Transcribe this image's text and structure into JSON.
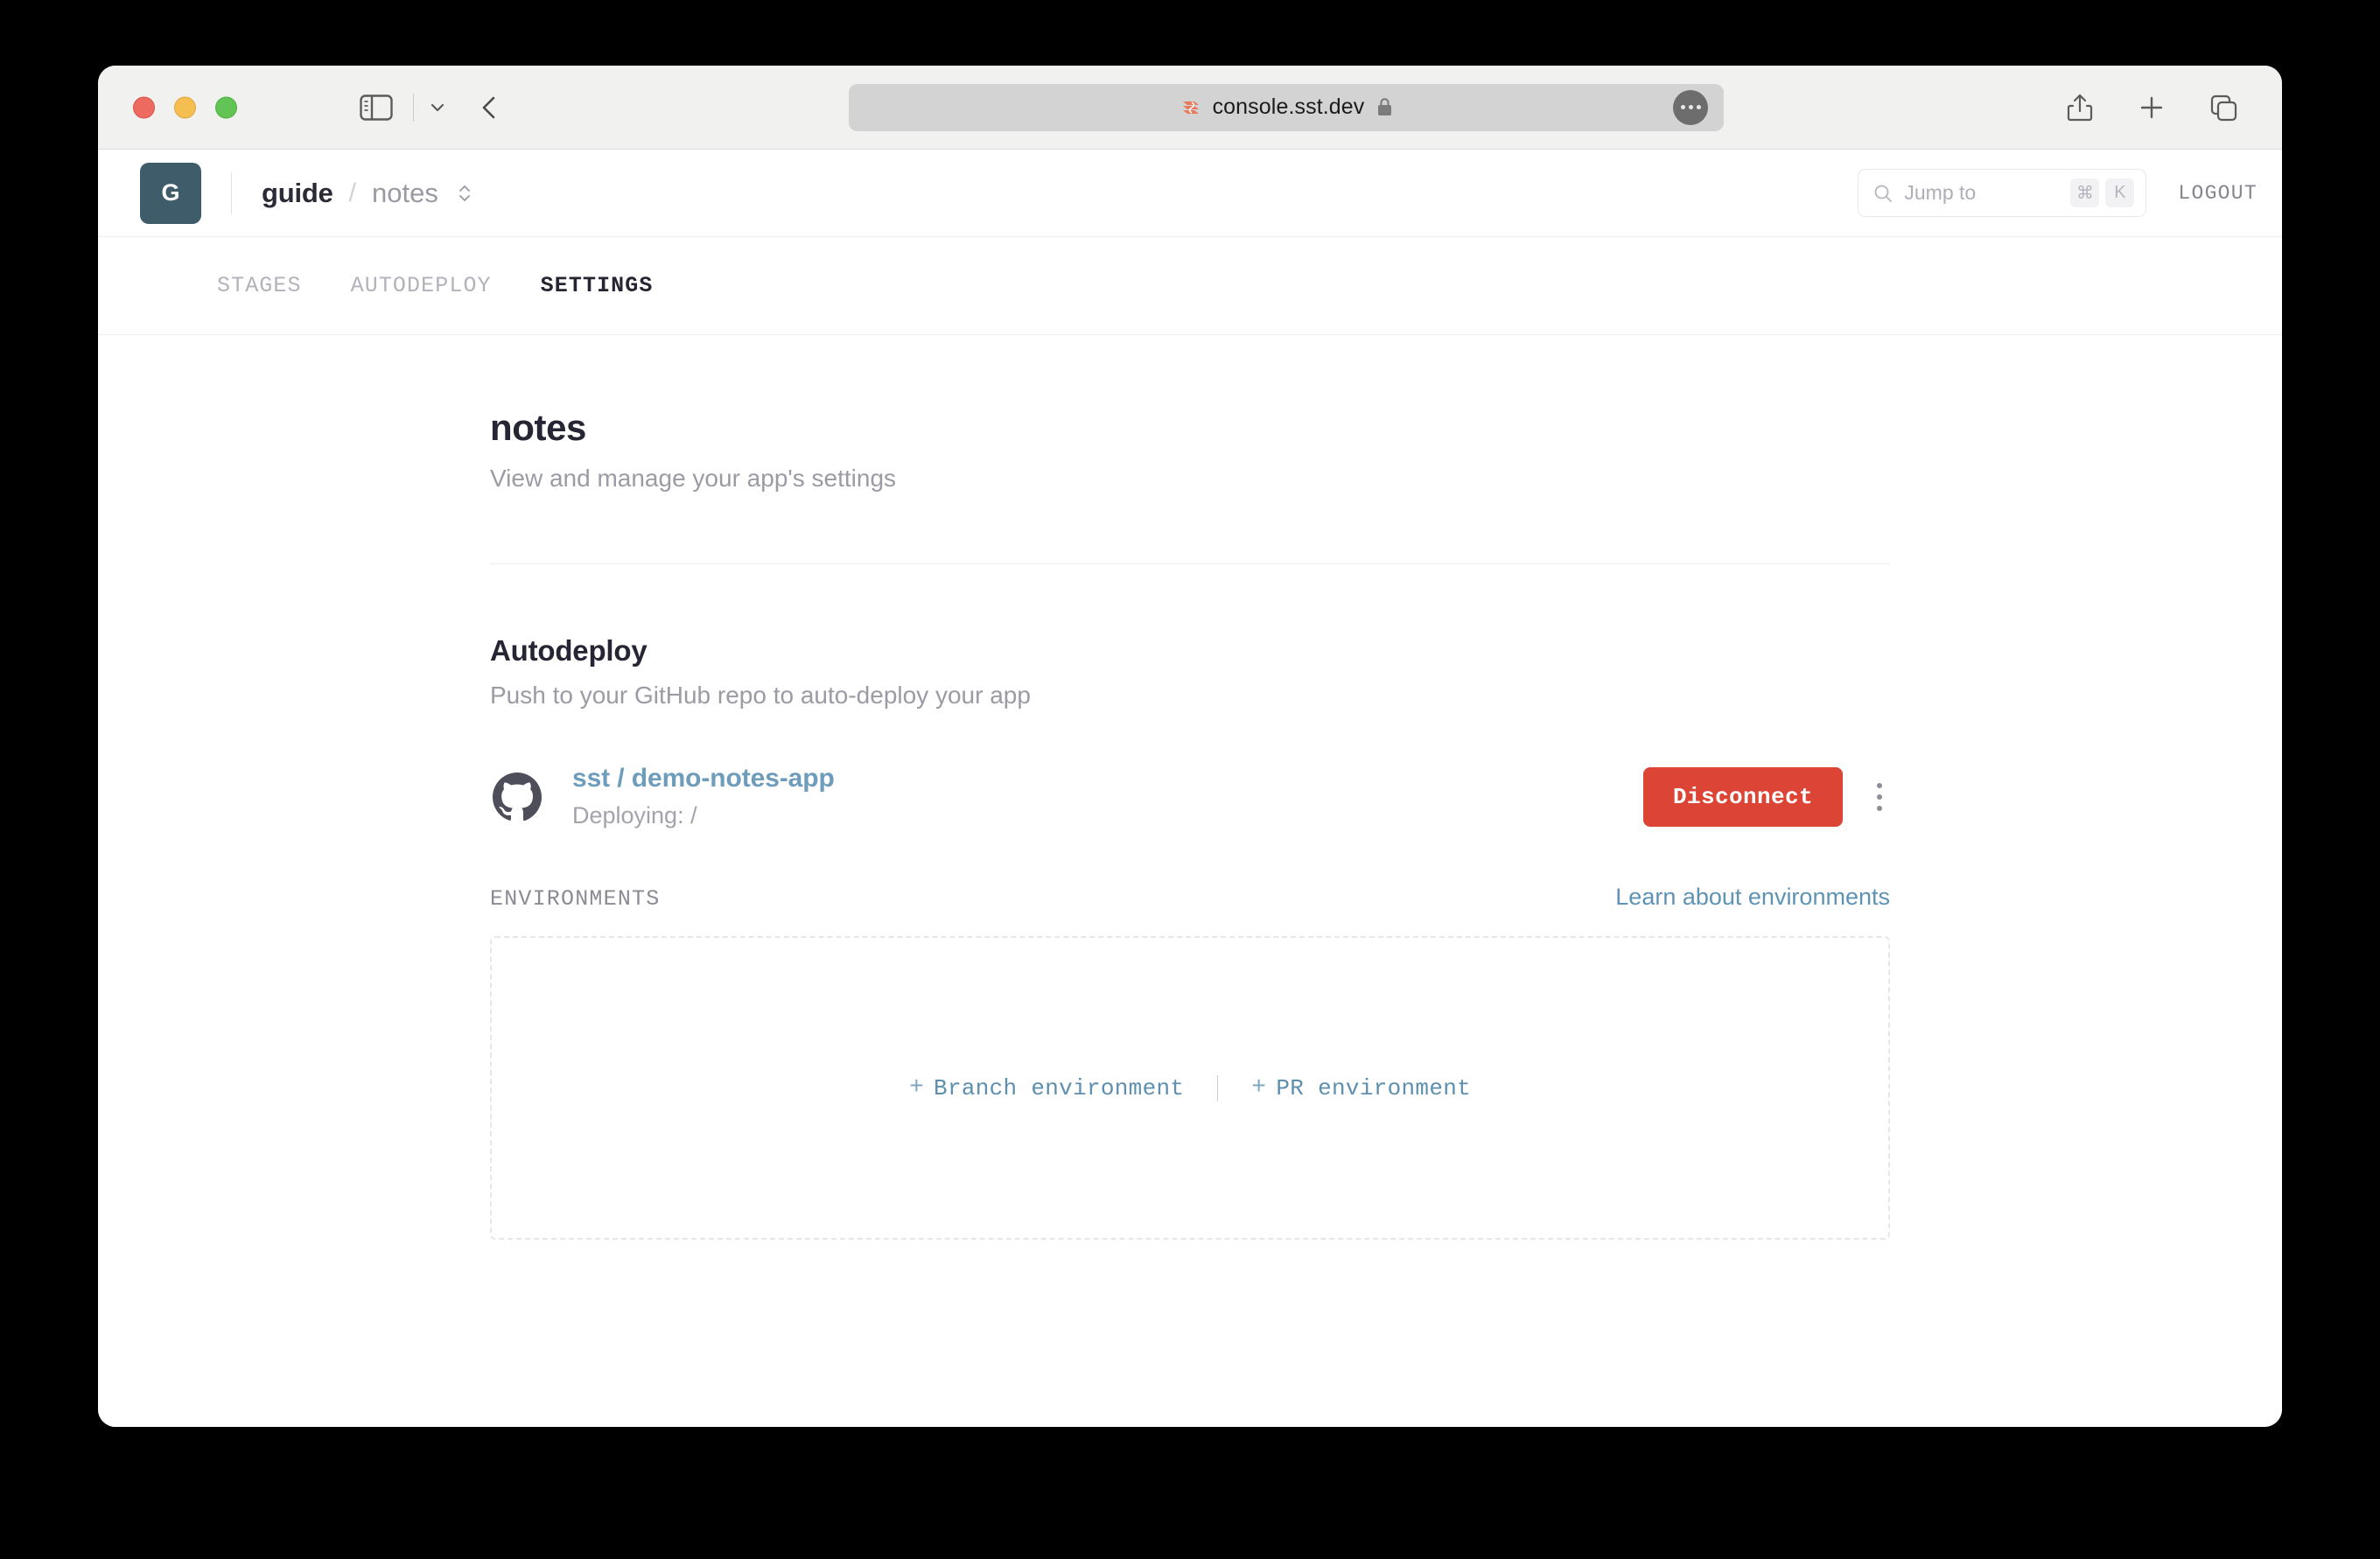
{
  "browser": {
    "url": "console.sst.dev",
    "favicon_icon": "sst-favicon-icon",
    "lock_icon": "lock-icon",
    "traffic_lights": [
      "close",
      "minimize",
      "zoom"
    ],
    "sidebar_toggle_icon": "sidebar-toggle-icon",
    "tab_dropdown_icon": "chevron-down-icon",
    "back_icon": "chevron-left-icon",
    "page_menu_icon": "ellipsis-icon",
    "share_icon": "share-icon",
    "new_tab_icon": "plus-icon",
    "tab_overview_icon": "tab-overview-icon"
  },
  "header": {
    "avatar_initial": "G",
    "breadcrumb": {
      "workspace": "guide",
      "separator": "/",
      "stage": "notes",
      "selector_icon": "chevron-up-down-icon"
    },
    "search": {
      "placeholder": "Jump to",
      "icon": "search-icon",
      "shortcut_keys": [
        "⌘",
        "K"
      ]
    },
    "logout_label": "LOGOUT"
  },
  "tabs": [
    {
      "label": "STAGES",
      "active": false
    },
    {
      "label": "AUTODEPLOY",
      "active": false
    },
    {
      "label": "SETTINGS",
      "active": true
    }
  ],
  "page": {
    "title": "notes",
    "subtitle": "View and manage your app's settings"
  },
  "autodeploy": {
    "title": "Autodeploy",
    "subtitle": "Push to your GitHub repo to auto-deploy your app",
    "repo": {
      "icon": "github-icon",
      "name": "sst / demo-notes-app",
      "status": "Deploying: /"
    },
    "disconnect_label": "Disconnect",
    "overflow_icon": "kebab-menu-icon",
    "environments": {
      "label": "ENVIRONMENTS",
      "learn_link": "Learn about environments",
      "actions": [
        {
          "plus": "+",
          "label": "Branch environment"
        },
        {
          "plus": "+",
          "label": "PR environment"
        }
      ]
    }
  },
  "colors": {
    "accent_blue": "#6d9dbb",
    "danger_red": "#dc4436",
    "avatar_bg": "#3f5c6b",
    "text_dark": "#252533",
    "text_muted": "#9b9ba5"
  }
}
